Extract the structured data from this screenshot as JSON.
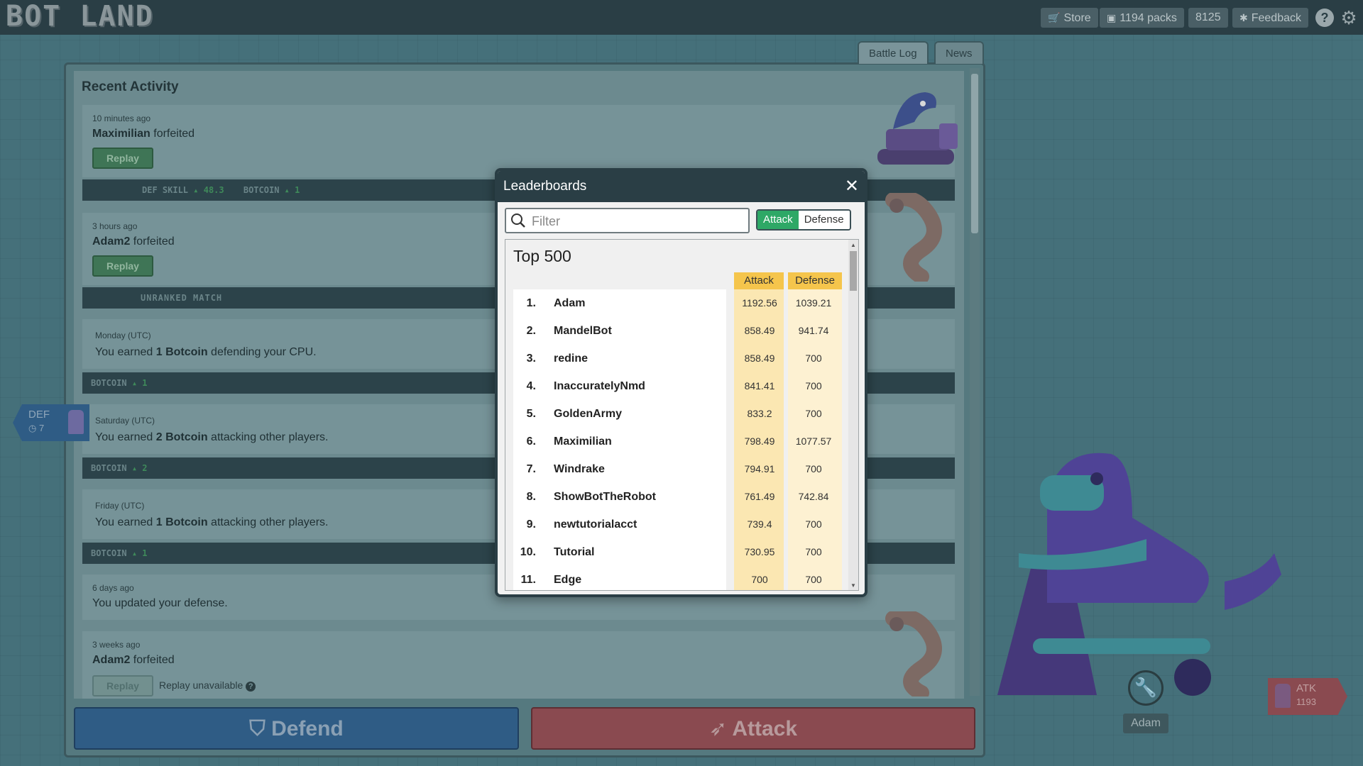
{
  "app": {
    "logo_text": "BOT LAND"
  },
  "topbar": {
    "store_label": "Store",
    "packs_label": "1194 packs",
    "currency": "8125",
    "feedback_label": "Feedback",
    "help_glyph": "?",
    "settings_glyph": "⚙"
  },
  "tabs": {
    "battle_log": "Battle Log",
    "news": "News"
  },
  "activity": {
    "title": "Recent Activity",
    "items": [
      {
        "time": "10 minutes ago",
        "actor": "Maximilian",
        "text": " forfeited",
        "replay": "Replay",
        "stats": "DEF SKILL",
        "stat1": "48.3",
        "stat2_label": "BOTCOIN",
        "stat2": "1"
      },
      {
        "time": "3 hours ago",
        "actor": "Adam2",
        "text": " forfeited",
        "replay": "Replay",
        "stats": "UNRANKED MATCH"
      },
      {
        "time": "Monday (UTC)",
        "pre": "You earned ",
        "amount": "1 Botcoin",
        "text": " defending your CPU.",
        "stats": "BOTCOIN",
        "stat1": "1"
      },
      {
        "time": "Saturday (UTC)",
        "pre": "You earned ",
        "amount": "2 Botcoin",
        "text": " attacking other players.",
        "stats": "BOTCOIN",
        "stat1": "2"
      },
      {
        "time": "Friday (UTC)",
        "pre": "You earned ",
        "amount": "1 Botcoin",
        "text": " attacking other players.",
        "stats": "BOTCOIN",
        "stat1": "1"
      },
      {
        "time": "6 days ago",
        "text": "You updated your defense."
      },
      {
        "time": "3 weeks ago",
        "actor": "Adam2",
        "text": " forfeited",
        "replay": "Replay",
        "unavailable": "Replay unavailable"
      }
    ]
  },
  "actions": {
    "defend": "Defend",
    "attack": "Attack"
  },
  "tags": {
    "def_label": "DEF",
    "def_value": "7",
    "atk_label": "ATK",
    "atk_value": "1193",
    "player_name": "Adam"
  },
  "modal": {
    "title": "Leaderboards",
    "close": "✕",
    "filter_placeholder": "Filter",
    "toggle_attack": "Attack",
    "toggle_defense": "Defense",
    "list_title": "Top 500",
    "col_attack": "Attack",
    "col_defense": "Defense",
    "rows": [
      {
        "rank": "1.",
        "name": "Adam",
        "attack": "1192.56",
        "defense": "1039.21"
      },
      {
        "rank": "2.",
        "name": "MandelBot",
        "attack": "858.49",
        "defense": "941.74"
      },
      {
        "rank": "3.",
        "name": "redine",
        "attack": "858.49",
        "defense": "700"
      },
      {
        "rank": "4.",
        "name": "InaccuratelyNmd",
        "attack": "841.41",
        "defense": "700"
      },
      {
        "rank": "5.",
        "name": "GoldenArmy",
        "attack": "833.2",
        "defense": "700"
      },
      {
        "rank": "6.",
        "name": "Maximilian",
        "attack": "798.49",
        "defense": "1077.57"
      },
      {
        "rank": "7.",
        "name": "Windrake",
        "attack": "794.91",
        "defense": "700"
      },
      {
        "rank": "8.",
        "name": "ShowBotTheRobot",
        "attack": "761.49",
        "defense": "742.84"
      },
      {
        "rank": "9.",
        "name": "newtutorialacct",
        "attack": "739.4",
        "defense": "700"
      },
      {
        "rank": "10.",
        "name": "Tutorial",
        "attack": "730.95",
        "defense": "700"
      },
      {
        "rank": "11.",
        "name": "Edge",
        "attack": "700",
        "defense": "700"
      }
    ]
  }
}
